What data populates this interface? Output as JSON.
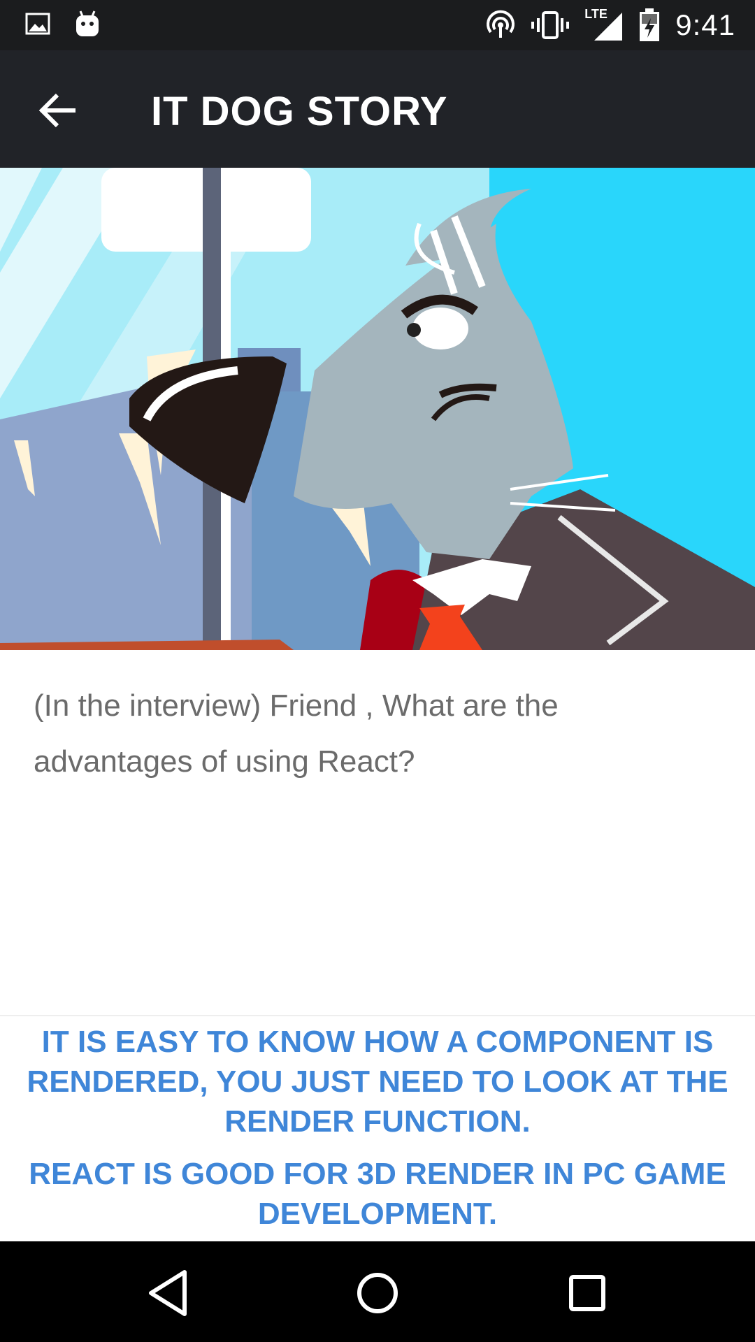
{
  "status_bar": {
    "time": "9:41",
    "network": "LTE",
    "icons": [
      "image-icon",
      "android-icon",
      "hotspot-icon",
      "vibrate-icon",
      "signal-icon",
      "battery-charging-icon"
    ]
  },
  "app_bar": {
    "title": "IT DOG STORY",
    "back_icon": "arrow-back-icon"
  },
  "content": {
    "question": "(In the interview) Friend , What are the advantages of using React?"
  },
  "answers": [
    {
      "label": "IT IS EASY TO KNOW HOW A COMPONENT IS RENDERED, YOU JUST NEED TO LOOK AT THE RENDER FUNCTION."
    },
    {
      "label": "REACT IS GOOD FOR 3D RENDER IN PC GAME DEVELOPMENT."
    }
  ],
  "nav_bar": {
    "icons": [
      "nav-back-icon",
      "nav-home-icon",
      "nav-recents-icon"
    ]
  },
  "colors": {
    "status_bar": "#1b1c1e",
    "app_bar": "#212328",
    "answer_text": "#3f86d8",
    "question_text": "#6b6b6b",
    "hero_sky": "#29d6fb"
  }
}
